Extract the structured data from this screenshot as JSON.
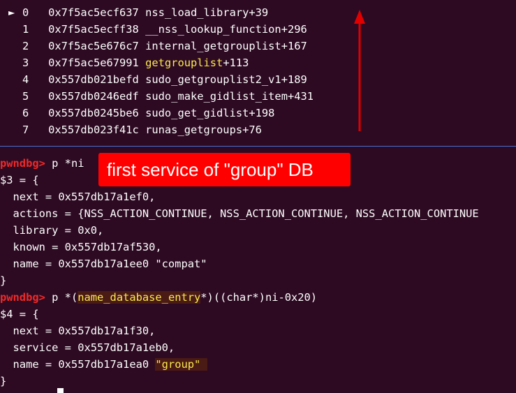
{
  "backtrace": [
    {
      "marker": "►",
      "index": "0",
      "addr": "0x7f5ac5ecf637",
      "func": "nss_load_library",
      "offset": "+39"
    },
    {
      "marker": "",
      "index": "1",
      "addr": "0x7f5ac5ecff38",
      "func": "__nss_lookup_function",
      "offset": "+296"
    },
    {
      "marker": "",
      "index": "2",
      "addr": "0x7f5ac5e676c7",
      "func": "internal_getgrouplist",
      "offset": "+167"
    },
    {
      "marker": "",
      "index": "3",
      "addr": "0x7f5ac5e67991",
      "func": "getgrouplist",
      "offset": "+113"
    },
    {
      "marker": "",
      "index": "4",
      "addr": "0x557db021befd",
      "func": "sudo_getgrouplist2_v1",
      "offset": "+189"
    },
    {
      "marker": "",
      "index": "5",
      "addr": "0x557db0246edf",
      "func": "sudo_make_gidlist_item",
      "offset": "+431"
    },
    {
      "marker": "",
      "index": "6",
      "addr": "0x557db0245be6",
      "func": "sudo_get_gidlist",
      "offset": "+198"
    },
    {
      "marker": "",
      "index": "7",
      "addr": "0x557db023f41c",
      "func": "runas_getgroups",
      "offset": "+76"
    }
  ],
  "callout": {
    "text": "first service of \"group\" DB"
  },
  "session": {
    "prompt": "pwndbg>",
    "cmd1": " p *ni",
    "result1_head": "$3 = {",
    "result1_fields": [
      "  next = 0x557db17a1ef0,",
      "  actions = {NSS_ACTION_CONTINUE, NSS_ACTION_CONTINUE, NSS_ACTION_CONTINUE",
      "  library = 0x0,",
      "  known = 0x557db17af530,",
      "  name = 0x557db17a1ee0 \"compat\""
    ],
    "close": "}",
    "cmd2_pre": " p *(",
    "cmd2_type": "name_database_entry",
    "cmd2_post": "*)((char*)ni-0x20)",
    "result2_head": "$4 = {",
    "result2_fields": [
      "  next = 0x557db17a1f30,",
      "  service = 0x557db17a1eb0,"
    ],
    "result2_name_pre": "  name = 0x557db17a1ea0 ",
    "result2_name_val": "\"group\" ",
    "close2": "}"
  },
  "colors": {
    "background": "#2d0a22",
    "prompt": "#ef2929",
    "highlight_text": "#fce94f",
    "callout_bg": "#ff0000",
    "arrow": "#e00000",
    "divider": "#4a6fd0"
  },
  "icons": {
    "current_frame": "play-arrow-icon",
    "annotation_arrow": "up-arrow-icon"
  }
}
